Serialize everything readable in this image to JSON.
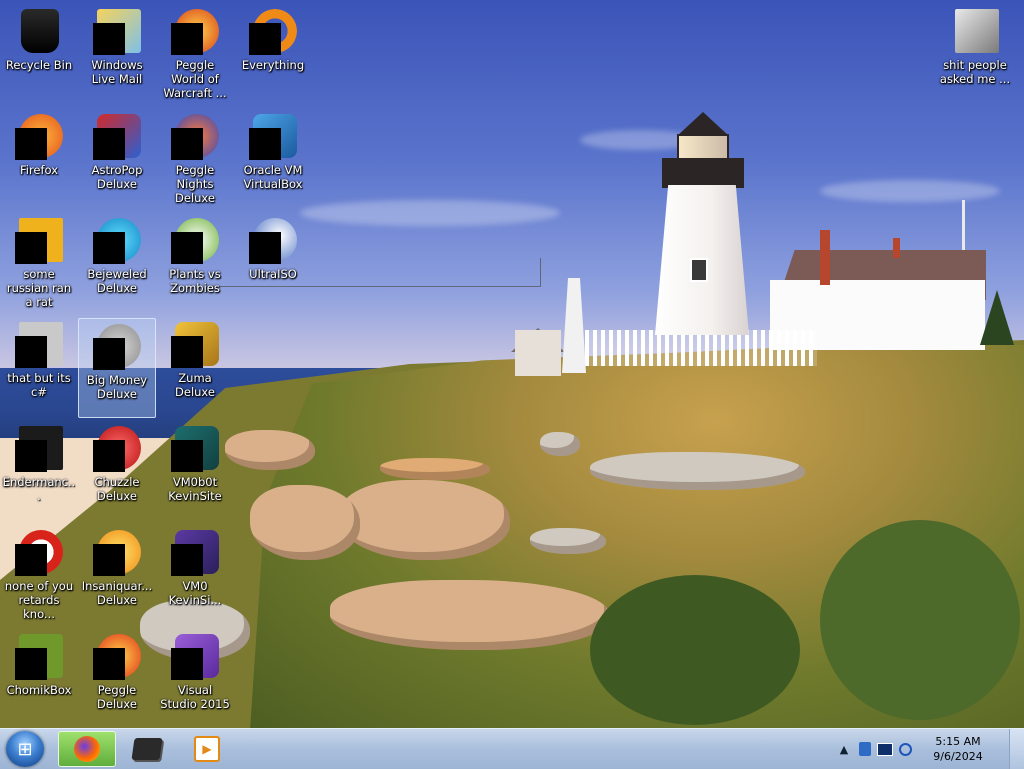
{
  "desktop": {
    "icons": [
      {
        "label": "Recycle Bin",
        "icon": "recycle-bin-icon"
      },
      {
        "label": "Windows Live Mail",
        "icon": "windows-live-mail-icon"
      },
      {
        "label": "Peggle World of Warcraft ...",
        "icon": "peggle-wow-icon"
      },
      {
        "label": "Everything",
        "icon": "everything-search-icon"
      },
      {
        "label": "shit people asked me ...",
        "icon": "folder-icon"
      },
      {
        "label": "Firefox",
        "icon": "firefox-icon"
      },
      {
        "label": "AstroPop Deluxe",
        "icon": "astropop-icon"
      },
      {
        "label": "Peggle Nights Deluxe",
        "icon": "peggle-nights-icon"
      },
      {
        "label": "Oracle VM VirtualBox",
        "icon": "virtualbox-icon"
      },
      {
        "label": "some russian ran a rat",
        "icon": "shortcut-icon"
      },
      {
        "label": "Bejeweled Deluxe",
        "icon": "bejeweled-icon"
      },
      {
        "label": "Plants vs Zombies",
        "icon": "plants-vs-zombies-icon"
      },
      {
        "label": "UltraISO",
        "icon": "ultraiso-icon"
      },
      {
        "label": "that but its c#",
        "icon": "shortcut-icon"
      },
      {
        "label": "Big Money Deluxe",
        "icon": "big-money-icon"
      },
      {
        "label": "Zuma Deluxe",
        "icon": "zuma-icon"
      },
      {
        "label": "Endermanc...",
        "icon": "console-app-icon"
      },
      {
        "label": "Chuzzle Deluxe",
        "icon": "chuzzle-icon"
      },
      {
        "label": "VM0b0t KevinSite",
        "icon": "vm-shortcut-icon"
      },
      {
        "label": "none of you retards kno...",
        "icon": "shortcut-icon"
      },
      {
        "label": "Insaniquar... Deluxe",
        "icon": "insaniquarium-icon"
      },
      {
        "label": "VM0 KevinSi...",
        "icon": "vm-shortcut-icon"
      },
      {
        "label": "ChomikBox",
        "icon": "chomikbox-icon"
      },
      {
        "label": "Peggle Deluxe",
        "icon": "peggle-icon"
      },
      {
        "label": "Visual Studio 2015",
        "icon": "visual-studio-icon"
      }
    ]
  },
  "taskbar": {
    "start_glyph": "⊞",
    "pinned": [
      {
        "icon": "firefox-icon",
        "active": true
      },
      {
        "icon": "terminal-icon",
        "active": false
      },
      {
        "icon": "media-player-icon",
        "active": false
      }
    ],
    "media_glyph": "▶",
    "tray": {
      "chevron": "▲",
      "icons": [
        "network-icon",
        "monitor-icon",
        "sync-icon"
      ]
    },
    "clock": {
      "time": "5:15 AM",
      "date": "9/6/2024"
    }
  },
  "colors": {
    "selection_bg": "#bed7f5",
    "taskbar_active": "#5fae3d"
  }
}
